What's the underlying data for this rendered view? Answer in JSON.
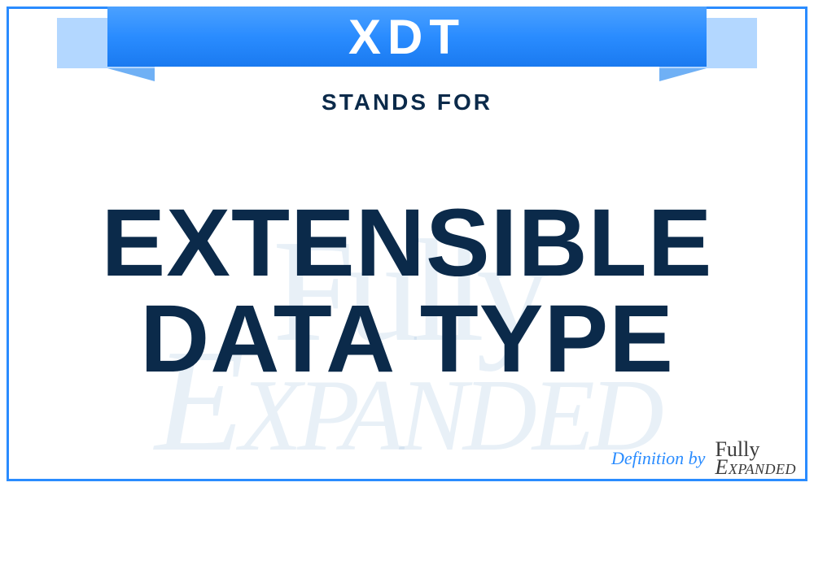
{
  "acronym": "XDT",
  "stands_for_label": "STANDS FOR",
  "definition": "EXTENSIBLE DATA TYPE",
  "watermark_line1": "Fully",
  "watermark_line2": "Expanded",
  "footer": {
    "definition_by": "Definition by",
    "logo_line1": "Fully",
    "logo_line2": "Expanded"
  },
  "colors": {
    "accent": "#2a8cff",
    "text_dark": "#0b2a4a"
  }
}
